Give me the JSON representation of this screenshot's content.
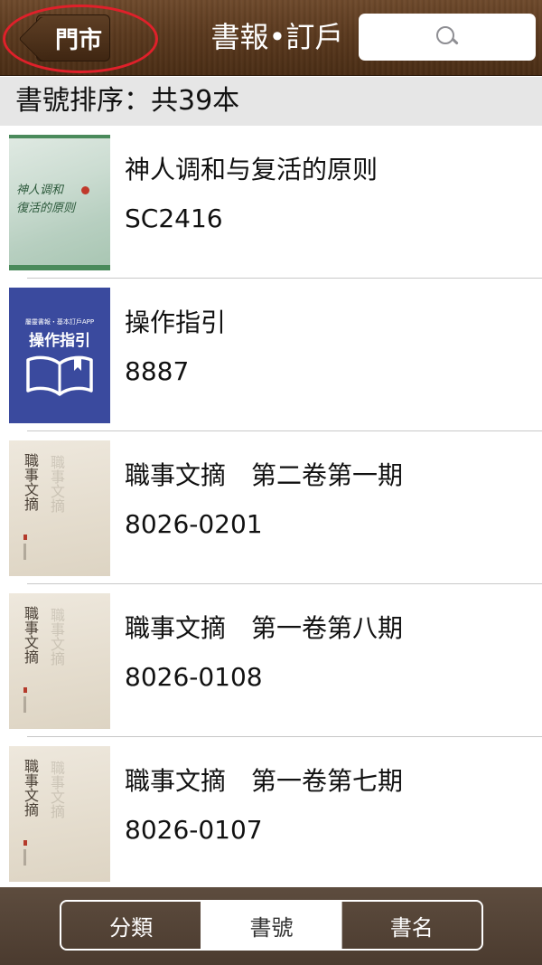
{
  "header": {
    "back_label": "門市",
    "title": "書報•訂戶",
    "search_placeholder": ""
  },
  "sort_bar": {
    "text": "書號排序：共39本"
  },
  "items": [
    {
      "title": "神人调和与复活的原则",
      "code": "SC2416",
      "cover_text": "神人调和",
      "cover_text2": "復活的原则"
    },
    {
      "title": "操作指引",
      "code": "8887",
      "cover_small": "屬靈書報・基本訂戶APP",
      "cover_big": "操作指引"
    },
    {
      "title": "職事文摘　第二卷第一期",
      "code": "8026-0201",
      "cover_text": "職事文摘"
    },
    {
      "title": "職事文摘　第一卷第八期",
      "code": "8026-0108",
      "cover_text": "職事文摘"
    },
    {
      "title": "職事文摘　第一卷第七期",
      "code": "8026-0107",
      "cover_text": "職事文摘"
    }
  ],
  "bottom_tabs": [
    {
      "label": "分類",
      "active": false
    },
    {
      "label": "書號",
      "active": true
    },
    {
      "label": "書名",
      "active": false
    }
  ],
  "colors": {
    "header_brown": "#5b3a1f",
    "highlight_red": "#e0202a",
    "sort_bar_bg": "#e6e6e6",
    "bottom_bar": "#4b3b2f"
  }
}
